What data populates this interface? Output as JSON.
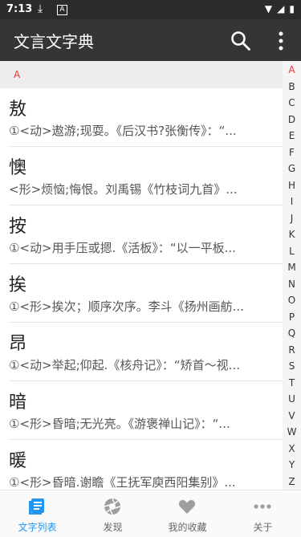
{
  "status": {
    "time": "7:13"
  },
  "app": {
    "title": "文言文字典"
  },
  "section": {
    "letter": "A"
  },
  "entries": [
    {
      "char": "敖",
      "desc": "①<动>遨游;现耍。《后汉书?张衡传》：“..."
    },
    {
      "char": "懊",
      "desc": "<形>烦恼;悔恨。刘禹锡《竹枝词九首》..."
    },
    {
      "char": "按",
      "desc": "①<动>用手压或摁.《活板》：“以一平板..."
    },
    {
      "char": "挨",
      "desc": "①<形>挨次；顺序次序。李斗《扬州画舫..."
    },
    {
      "char": "昂",
      "desc": "①<动>举起;仰起.《核舟记》：“矫首～视..."
    },
    {
      "char": "暗",
      "desc": "①<形>昏暗;无光亮。《游褒禅山记》：“..."
    },
    {
      "char": "暖",
      "desc": "①<形>昏暗.谢瞻《王抚军庾西阳集别》..."
    }
  ],
  "index_letters": [
    "A",
    "B",
    "C",
    "D",
    "E",
    "F",
    "G",
    "H",
    "I",
    "J",
    "K",
    "L",
    "M",
    "N",
    "O",
    "P",
    "Q",
    "R",
    "S",
    "T",
    "U",
    "V",
    "W",
    "X",
    "Y",
    "Z"
  ],
  "tabs": [
    {
      "label": "文字列表"
    },
    {
      "label": "发现"
    },
    {
      "label": "我的收藏"
    },
    {
      "label": "关于"
    }
  ],
  "colors": {
    "accent": "#2196f3",
    "index_active": "#e53935",
    "appbar": "#353535"
  }
}
